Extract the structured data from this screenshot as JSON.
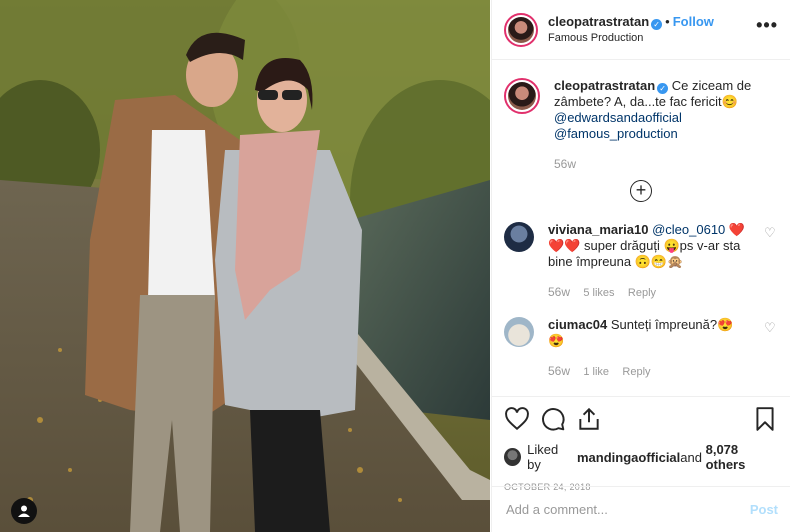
{
  "post": {
    "author": "cleopatrastratan",
    "follow_label": "Follow",
    "dot": "•",
    "location": "Famous Production",
    "more": "•••",
    "caption_part1": "Ce ziceam de zâmbete? A, da...te fac fericit",
    "caption_emoji": "😊",
    "mention1": "@edwardsandaofficial",
    "mention2": "@famous_production",
    "caption_age": "56w"
  },
  "comments": [
    {
      "user": "viviana_maria10",
      "mention": "@cleo_0610",
      "text_a": "❤️",
      "text_b": "❤️❤️ super drăguți 😛ps v-ar sta bine împreuna 🙃😁🙊",
      "age": "56w",
      "likes": "5 likes",
      "reply": "Reply"
    },
    {
      "user": "ciumac04",
      "text": "Sunteți împreună?😍",
      "text_b": "😍",
      "age": "56w",
      "likes": "1 like",
      "reply": "Reply"
    }
  ],
  "likes": {
    "prefix": "Liked by ",
    "user": "mandingaofficial",
    "mid": " and ",
    "count": "8,078 others"
  },
  "date": "OCTOBER 24, 2018",
  "add_comment": {
    "placeholder": "Add a comment...",
    "post_label": "Post"
  },
  "icons": {
    "verified": "verified-badge-icon",
    "like": "heart-icon",
    "comment": "comment-bubble-icon",
    "share": "share-icon",
    "save": "bookmark-icon",
    "tag": "user-tag-icon",
    "load_more": "plus-circle-icon"
  },
  "colors": {
    "accent": "#3897f0",
    "like_red": "#ed4956",
    "muted": "#999999"
  }
}
